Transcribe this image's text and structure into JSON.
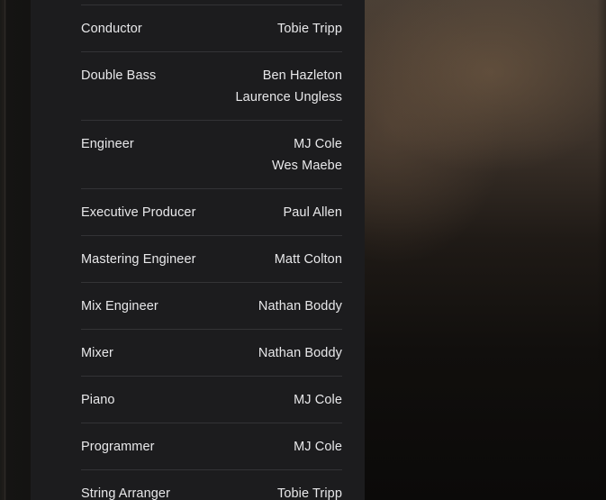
{
  "credits": [
    {
      "role": "Conductor",
      "names": [
        "Tobie Tripp"
      ]
    },
    {
      "role": "Double Bass",
      "names": [
        "Ben Hazleton",
        "Laurence Ungless"
      ]
    },
    {
      "role": "Engineer",
      "names": [
        "MJ Cole",
        "Wes Maebe"
      ]
    },
    {
      "role": "Executive Producer",
      "names": [
        "Paul Allen"
      ]
    },
    {
      "role": "Mastering Engineer",
      "names": [
        "Matt Colton"
      ]
    },
    {
      "role": "Mix Engineer",
      "names": [
        "Nathan Boddy"
      ]
    },
    {
      "role": "Mixer",
      "names": [
        "Nathan Boddy"
      ]
    },
    {
      "role": "Piano",
      "names": [
        "MJ Cole"
      ]
    },
    {
      "role": "Programmer",
      "names": [
        "MJ Cole"
      ]
    },
    {
      "role": "String Arranger",
      "names": [
        "Tobie Tripp"
      ]
    }
  ],
  "colors": {
    "panel_background": "#1c1c1e",
    "text": "#e8e8ea",
    "divider": "#333336"
  }
}
